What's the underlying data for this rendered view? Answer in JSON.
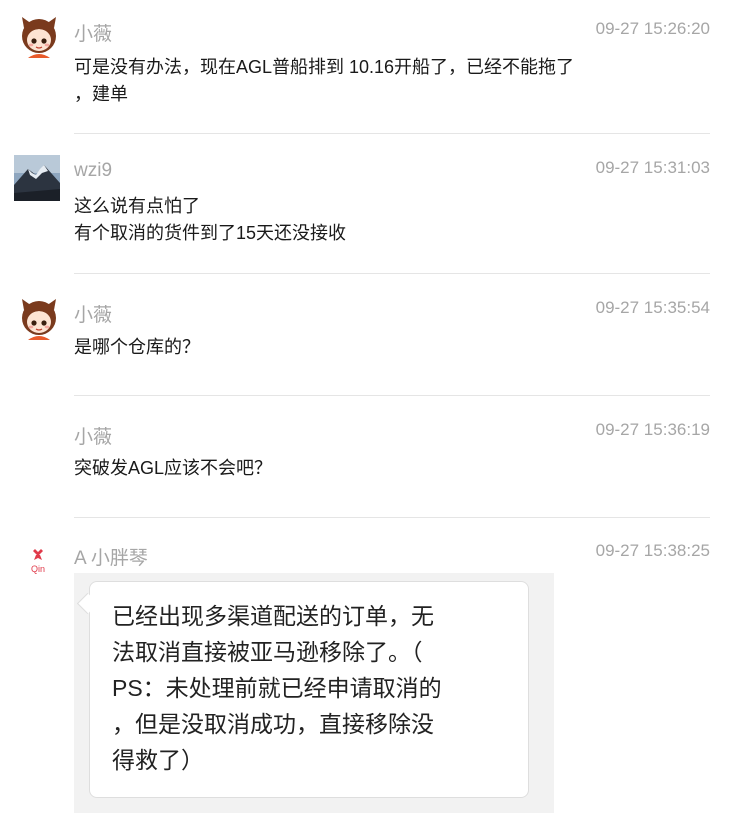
{
  "messages": [
    {
      "sender": "小薇",
      "time": "09-27 15:26:20",
      "text": "可是没有办法，现在AGL普船排到 10.16开船了，已经不能拖了\n，建单"
    },
    {
      "sender": "wzi9",
      "time": "09-27 15:31:03",
      "text": "这么说有点怕了\n有个取消的货件到了15天还没接收"
    },
    {
      "sender": "小薇",
      "time": "09-27 15:35:54",
      "text": "是哪个仓库的？"
    },
    {
      "sender": "小薇",
      "time": "09-27 15:36:19",
      "text": "突破发AGL应该不会吧？"
    },
    {
      "sender": "A 小胖琴",
      "time": "09-27 15:38:25",
      "avatar_text": "Qin",
      "quote": "已经出现多渠道配送的订单，无\n法取消直接被亚马逊移除了。（\nPS：未处理前就已经申请取消的\n，但是没取消成功，直接移除没\n得救了）"
    }
  ],
  "colors": {
    "meta": "#a6a6a6",
    "text": "#1a1a1a",
    "divider": "#e5e5e5",
    "qin_accent": "#e03a4a"
  }
}
